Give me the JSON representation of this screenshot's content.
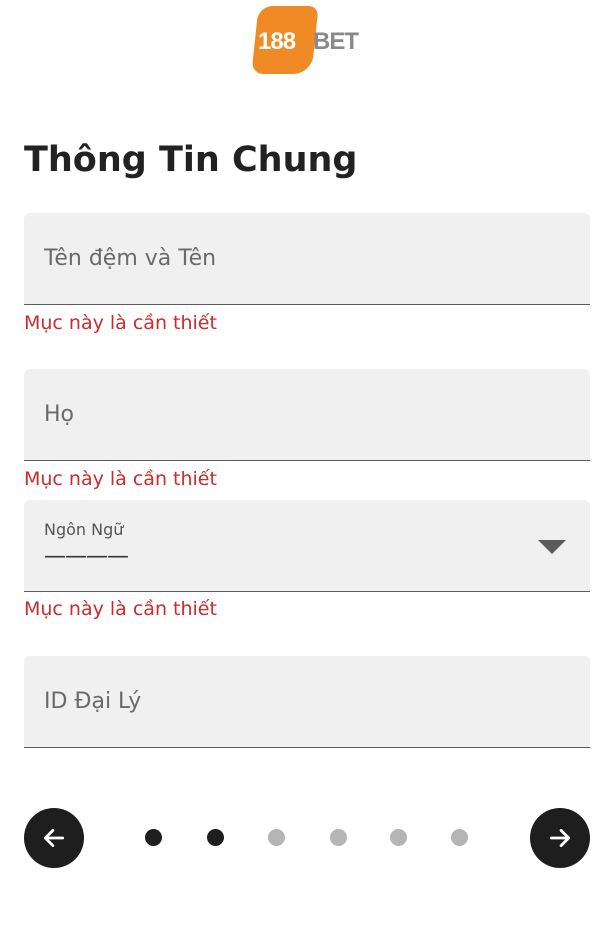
{
  "brand": {
    "logo_number": "188",
    "logo_text": "BET",
    "badge_color": "#f08a24"
  },
  "form": {
    "title": "Thông Tin Chung",
    "first_name": {
      "placeholder": "Tên đệm và Tên",
      "value": "",
      "error": "Mục này là cần thiết"
    },
    "last_name": {
      "placeholder": "Họ",
      "value": "",
      "error": "Mục này là cần thiết"
    },
    "language": {
      "label": "Ngôn Ngữ",
      "value": "————",
      "error": "Mục này là cần thiết"
    },
    "affiliate_id": {
      "placeholder": "ID Đại Lý",
      "value": ""
    }
  },
  "navigation": {
    "prev_icon": "arrow-left-icon",
    "next_icon": "arrow-right-icon",
    "total_steps": 6,
    "active_steps": 2
  },
  "colors": {
    "error": "#cc2b2b",
    "field_bg": "#f0f0f0",
    "nav_dark": "#1e1e1e",
    "dot_inactive": "#b5b5b5"
  }
}
